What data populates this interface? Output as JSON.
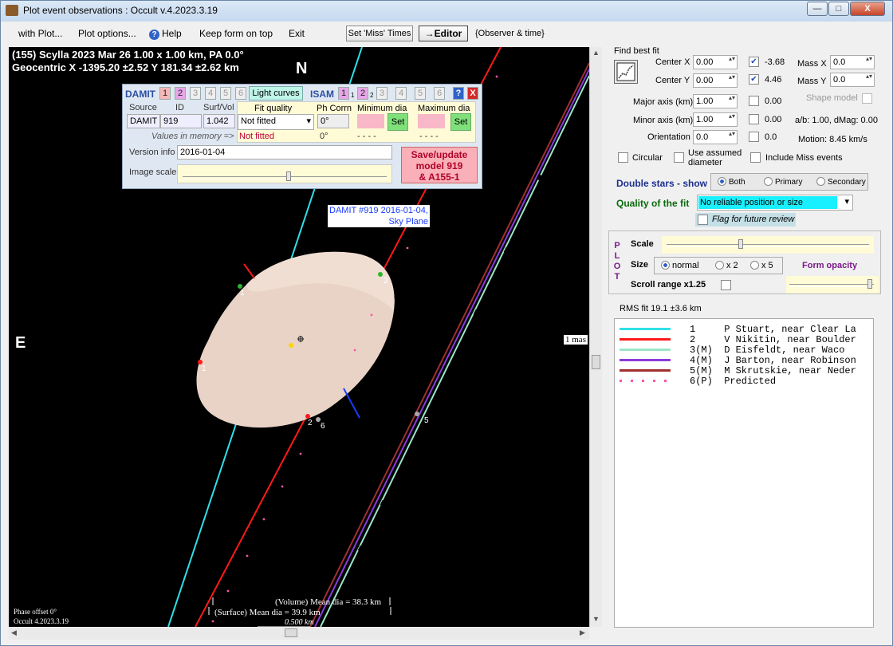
{
  "window": {
    "title": "Plot event observations : Occult v.4.2023.3.19",
    "minimize": "—",
    "maximize": "□",
    "close": "X"
  },
  "menu": {
    "with_plot": "with Plot...",
    "plot_options": "Plot options...",
    "help": "Help",
    "keep_on_top": "Keep form on top",
    "exit": "Exit",
    "set_miss_times": "Set 'Miss' Times",
    "editor": "→Editor",
    "observer_time": "{Observer & time}"
  },
  "plot": {
    "header_line1": "(155) Scylla  2023 Mar 26   1.00 x 1.00 km,  PA 0.0°",
    "header_line2": "Geocentric  X  -1395.20 ±2.52  Y 181.34 ±2.62 km",
    "north": "N",
    "east": "E",
    "model_label1": "DAMIT #919 2016-01-04,",
    "model_label2": "Sky Plane",
    "mas": "1 mas",
    "volume_dia": "(Volume) Mean dia = 38.3 km",
    "surface_dia": "(Surface) Mean dia = 39.9 km",
    "scale_km": "0.500 km",
    "phase_offset": "Phase offset 0°",
    "version": "Occult 4.2023.3.19",
    "chord_labels": [
      "1",
      "2",
      "1",
      "2",
      "6",
      "5"
    ]
  },
  "model_panel": {
    "damit": "DAMIT",
    "isam": "ISAM",
    "light_curves": "Light curves",
    "damit_nums": [
      "1",
      "2",
      "3",
      "4",
      "5",
      "6"
    ],
    "isam_nums": [
      "1",
      "2",
      "3",
      "4",
      "5",
      "6"
    ],
    "isam_subs": [
      "1",
      "2"
    ],
    "help": "?",
    "close": "X",
    "col_source": "Source",
    "col_id": "ID",
    "col_surfvol": "Surf/Vol",
    "col_fit": "Fit quality",
    "col_phcorr": "Ph Corrn",
    "col_min": "Minimum dia",
    "col_max": "Maximum dia",
    "source": "DAMIT",
    "id": "919",
    "surfvol": "1.042",
    "fit_select": "Not fitted",
    "fit_memory": "Not fitted",
    "ph1": "0°",
    "ph2": "0°",
    "dash1": "- - - -",
    "dash2": "- - - -",
    "set": "Set",
    "values_memory": "Values in memory =>",
    "version_info_label": "Version info",
    "version_info": "2016-01-04",
    "image_scale": "Image scale",
    "save_update": "Save/update",
    "save_model": "model 919",
    "save_id": "& A155-1"
  },
  "right": {
    "find_best_fit": "Find best fit",
    "center_x_label": "Center X",
    "center_x": "0.00",
    "center_y_label": "Center Y",
    "center_y": "0.00",
    "cx_val": "-3.68",
    "cy_val": "4.46",
    "mass_x_label": "Mass X",
    "mass_x": "0.0",
    "mass_y_label": "Mass Y",
    "mass_y": "0.0",
    "major_label": "Major axis (km)",
    "major": "1.00",
    "major_val": "0.00",
    "minor_label": "Minor axis (km)",
    "minor": "1.00",
    "minor_val": "0.00",
    "orientation_label": "Orientation",
    "orientation": "0.0",
    "orientation_val": "0.0",
    "shape_model": "Shape model",
    "ab": "a/b: 1.00, dMag: 0.00",
    "motion": "Motion: 8.45 km/s",
    "circular": "Circular",
    "use_assumed": "Use assumed",
    "diameter": "diameter",
    "include_miss": "Include Miss events",
    "double_stars": "Double stars - show",
    "both": "Both",
    "primary": "Primary",
    "secondary": "Secondary",
    "quality_label": "Quality of the fit",
    "quality_value": "No reliable position or size",
    "flag_review": "Flag for future review",
    "plot_letters": [
      "P",
      "L",
      "O",
      "T"
    ],
    "scale": "Scale",
    "size": "Size",
    "normal": "normal",
    "x2": "x 2",
    "x5": "x 5",
    "form_opacity": "Form opacity",
    "scroll_range": "Scroll range x1.25",
    "rms": "RMS fit 19.1 ±3.6 km"
  },
  "legend": [
    {
      "color": "#2fe0e6",
      "text": "1     P Stuart, near Clear La"
    },
    {
      "color": "#ff1a1a",
      "text": "2     V Nikitin, near Boulder"
    },
    {
      "color": "#9ce6c8",
      "text": "3(M)  D Eisfeldt, near Waco"
    },
    {
      "color": "#8a3cdc",
      "text": "4(M)  J Barton, near Robinson"
    },
    {
      "color": "#a03030",
      "text": "5(M)  M Skrutskie, near Neder"
    },
    {
      "color": "#ff55aa",
      "text": "6(P)  Predicted"
    }
  ]
}
